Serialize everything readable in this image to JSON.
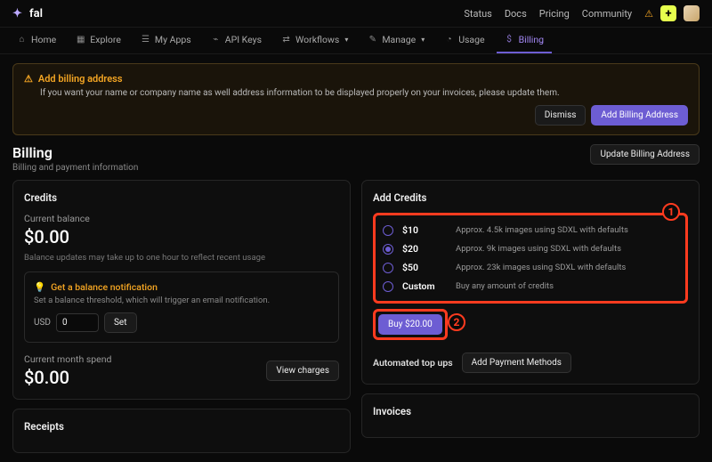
{
  "brand": "fal",
  "top_links": [
    "Status",
    "Docs",
    "Pricing",
    "Community"
  ],
  "nav": [
    {
      "icon": "⌂",
      "label": "Home"
    },
    {
      "icon": "▦",
      "label": "Explore"
    },
    {
      "icon": "☰",
      "label": "My Apps"
    },
    {
      "icon": "⌁",
      "label": "API Keys"
    },
    {
      "icon": "⇄",
      "label": "Workflows",
      "chev": true
    },
    {
      "icon": "✎",
      "label": "Manage",
      "chev": true
    },
    {
      "icon": "◔",
      "label": "Usage"
    },
    {
      "icon": "$",
      "label": "Billing",
      "active": true
    }
  ],
  "alert": {
    "title": "Add billing address",
    "body": "If you want your name or company name as well address information to be displayed properly on your invoices, please update them.",
    "dismiss": "Dismiss",
    "cta": "Add Billing Address"
  },
  "page": {
    "title": "Billing",
    "sub": "Billing and payment information",
    "update_btn": "Update Billing Address"
  },
  "credits": {
    "title": "Credits",
    "balance_label": "Current balance",
    "balance": "$0.00",
    "hint": "Balance updates may take up to one hour to reflect recent usage",
    "notif_title": "Get a balance notification",
    "notif_sub": "Set a balance threshold, which will trigger an email notification.",
    "currency": "USD",
    "threshold": "0",
    "set": "Set",
    "spend_label": "Current month spend",
    "spend": "$0.00",
    "view_charges": "View charges"
  },
  "add": {
    "title": "Add Credits",
    "options": [
      {
        "label": "$10",
        "desc": "Approx. 4.5k images using SDXL with defaults",
        "selected": false
      },
      {
        "label": "$20",
        "desc": "Approx. 9k images using SDXL with defaults",
        "selected": true
      },
      {
        "label": "$50",
        "desc": "Approx. 23k images using SDXL with defaults",
        "selected": false
      },
      {
        "label": "Custom",
        "desc": "Buy any amount of credits",
        "selected": false
      }
    ],
    "buy": "Buy $20.00",
    "auto_label": "Automated top ups",
    "add_pm": "Add Payment Methods"
  },
  "receipts": {
    "title": "Receipts"
  },
  "invoices": {
    "title": "Invoices"
  },
  "annot": {
    "one": "1",
    "two": "2"
  }
}
